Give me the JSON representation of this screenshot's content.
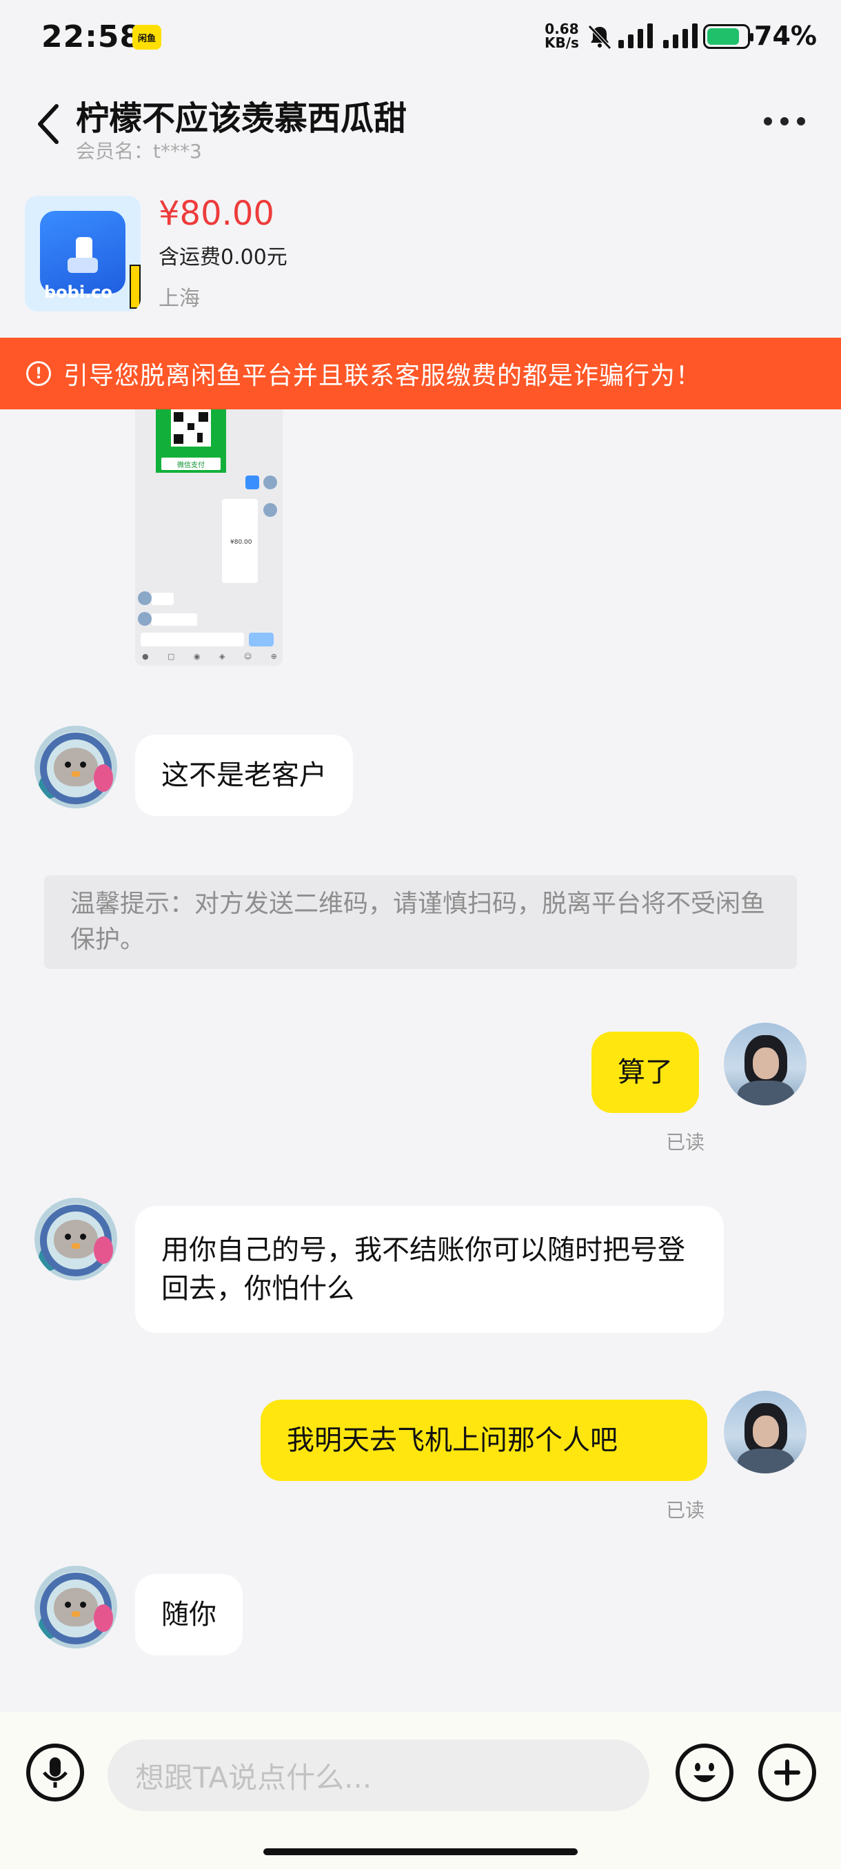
{
  "status_bar": {
    "time": "22:58",
    "app_badge": "闲鱼",
    "net_speed_value": "0.68",
    "net_speed_unit": "KB/s",
    "battery": "74%"
  },
  "header": {
    "title": "柠檬不应该羡慕西瓜甜",
    "member": "会员名：t***3"
  },
  "product": {
    "image_label": "bobi.co",
    "price": "¥80.00",
    "shipping": "含运费0.00元",
    "location": "上海"
  },
  "warning_banner": {
    "icon": "warning-icon",
    "text": "引导您脱离闲鱼平台并且联系客服缴费的都是诈骗行为！"
  },
  "thumbnail": {
    "pay_caption": "微信支付",
    "mini_price": "¥80.00"
  },
  "messages": [
    {
      "side": "left",
      "text": "这不是老客户"
    },
    {
      "side": "system",
      "text": "温馨提示：对方发送二维码，请谨慎扫码，脱离平台将不受闲鱼保护。"
    },
    {
      "side": "right",
      "text": "算了",
      "status": "已读"
    },
    {
      "side": "left",
      "text": "用你自己的号，我不结账你可以随时把号登回去，你怕什么"
    },
    {
      "side": "right",
      "text": "我明天去飞机上问那个人吧",
      "status": "已读"
    },
    {
      "side": "left",
      "text": "随你"
    }
  ],
  "input_bar": {
    "placeholder": "想跟TA说点什么..."
  },
  "colors": {
    "accent_yellow": "#ffe60f",
    "warning_orange": "#ff5727",
    "price_red": "#ee3b3b"
  }
}
